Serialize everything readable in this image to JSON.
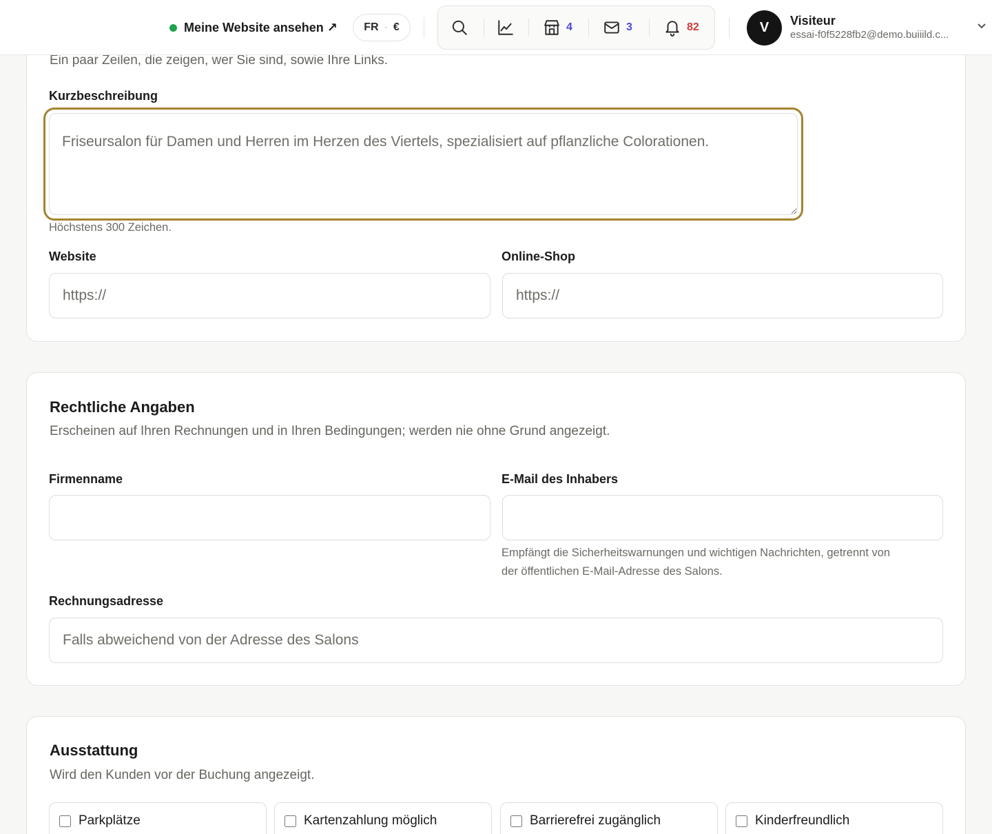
{
  "topbar": {
    "site_link_label": "Meine Website ansehen ↗",
    "locale": {
      "language": "FR",
      "separator": "·",
      "currency": "€"
    },
    "tools": {
      "search_icon": "search-icon",
      "stats_icon": "chart-icon",
      "shop_icon": "storefront-icon",
      "shop_count": "4",
      "mail_icon": "mail-icon",
      "mail_count": "3",
      "bell_icon": "bell-icon",
      "bell_count": "82"
    },
    "user": {
      "initial": "V",
      "name": "Visiteur",
      "email": "essai-f0f5228fb2@demo.buiiild.c..."
    }
  },
  "profile_card": {
    "subtitle": "Ein paar Zeilen, die zeigen, wer Sie sind, sowie Ihre Links.",
    "short_description": {
      "label": "Kurzbeschreibung",
      "placeholder": "Friseursalon für Damen und Herren im Herzen des Viertels, spezialisiert auf pflanzliche Colorationen.",
      "value": "",
      "helper": "Höchstens 300 Zeichen."
    },
    "website": {
      "label": "Website",
      "placeholder": "https://",
      "value": ""
    },
    "online_shop": {
      "label": "Online-Shop",
      "placeholder": "https://",
      "value": ""
    }
  },
  "legal_card": {
    "title": "Rechtliche Angaben",
    "subtitle": "Erscheinen auf Ihren Rechnungen und in Ihren Bedingungen; werden nie ohne Grund angezeigt.",
    "company_name": {
      "label": "Firmenname",
      "placeholder": "",
      "value": ""
    },
    "owner_email": {
      "label": "E-Mail des Inhabers",
      "placeholder": "",
      "value": "",
      "helper_line1": "Empfängt die Sicherheitswarnungen und wichtigen Nachrichten, getrennt von",
      "helper_line2": "der öffentlichen E-Mail-Adresse des Salons."
    },
    "billing_address": {
      "label": "Rechnungsadresse",
      "placeholder": "Falls abweichend von der Adresse des Salons",
      "value": ""
    }
  },
  "amenities_card": {
    "title": "Ausstattung",
    "subtitle": "Wird den Kunden vor der Buchung angezeigt.",
    "options": [
      {
        "label": "Parkplätze",
        "checked": false
      },
      {
        "label": "Kartenzahlung möglich",
        "checked": false
      },
      {
        "label": "Barrierefrei zugänglich",
        "checked": false
      },
      {
        "label": "Kinderfreundlich",
        "checked": false
      }
    ]
  },
  "colors": {
    "accent_focus_ring": "#a4832f",
    "status_online": "#1fa34a",
    "badge_blue": "#4a47d6",
    "badge_red": "#d23a3a"
  }
}
